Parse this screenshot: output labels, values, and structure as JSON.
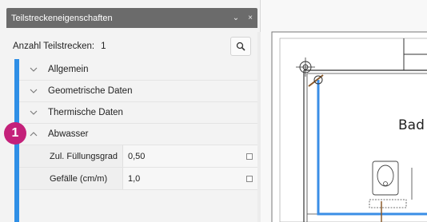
{
  "panel": {
    "title": "Teilstreckeneigenschaften",
    "title_buttons": [
      "⌄",
      "×"
    ],
    "count_label": "Anzahl Teilstrecken:",
    "count_value": "1",
    "groups": [
      {
        "label": "Allgemein",
        "expanded": false
      },
      {
        "label": "Geometrische Daten",
        "expanded": false
      },
      {
        "label": "Thermische Daten",
        "expanded": false
      },
      {
        "label": "Abwasser",
        "expanded": true
      }
    ],
    "properties": [
      {
        "label": "Zul. Füllungsgrad",
        "value": "0,50"
      },
      {
        "label": "Gefälle (cm/m)",
        "value": "1,0"
      }
    ],
    "callout_number": "1",
    "accent_color": "#2f8fe6",
    "callout_color": "#c4217a"
  },
  "drawing": {
    "room_label": "Bad",
    "pipe_color": "#3a8ee6"
  },
  "icons": [
    "search-icon",
    "chevron-down-icon",
    "chevron-up-icon",
    "close-icon",
    "checkbox-icon",
    "toilet-symbol",
    "target-symbol"
  ]
}
